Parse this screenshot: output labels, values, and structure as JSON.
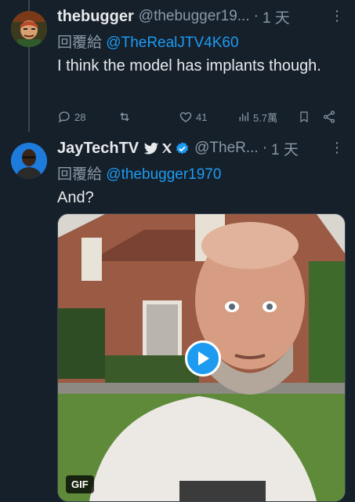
{
  "tweet1": {
    "name": "thebugger",
    "handle": "@thebugger19...",
    "dot": "·",
    "time": "1 天",
    "more": "⋮",
    "reply_prefix": "回覆給",
    "reply_to": "@TheRealJTV4K60",
    "text": "I think the model has implants though.",
    "replies": "28",
    "likes": "41",
    "views": "5.7萬"
  },
  "tweet2": {
    "name": "JayTechTV",
    "badge_text": "🐦𝕏",
    "handle": "@TheR...",
    "dot": "·",
    "time": "1 天",
    "more": "⋮",
    "reply_prefix": "回覆給",
    "reply_to": "@thebugger1970",
    "text": "And?",
    "media_label": "GIF"
  },
  "colors": {
    "background": "#15202b",
    "accent": "#1d9bf0",
    "muted": "#8b98a5",
    "text": "#e7e9ea"
  }
}
